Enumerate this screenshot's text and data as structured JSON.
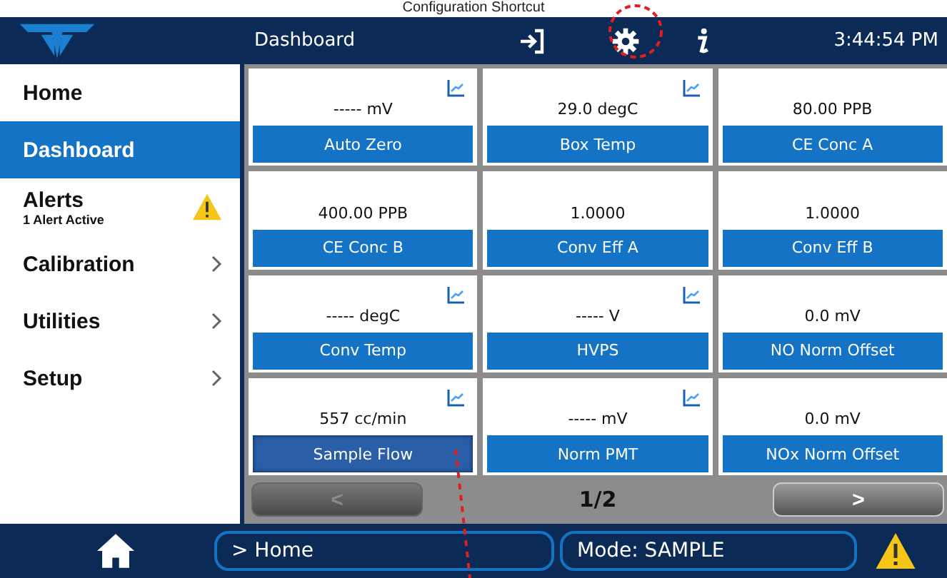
{
  "annotation": {
    "caption": "Configuration Shortcut"
  },
  "header": {
    "title": "Dashboard",
    "time": "3:44:54 PM"
  },
  "sidebar": {
    "items": [
      {
        "label": "Home",
        "selected": false,
        "kind": "plain"
      },
      {
        "label": "Dashboard",
        "selected": true,
        "kind": "plain"
      },
      {
        "label": "Alerts",
        "sub": "1 Alert Active",
        "selected": false,
        "kind": "alert"
      },
      {
        "label": "Calibration",
        "selected": false,
        "kind": "submenu"
      },
      {
        "label": "Utilities",
        "selected": false,
        "kind": "submenu"
      },
      {
        "label": "Setup",
        "selected": false,
        "kind": "submenu"
      }
    ]
  },
  "tiles": [
    {
      "value": "----- mV",
      "label": "Auto Zero",
      "trend": true,
      "selected": false
    },
    {
      "value": "29.0 degC",
      "label": "Box Temp",
      "trend": true,
      "selected": false
    },
    {
      "value": "80.00 PPB",
      "label": "CE Conc A",
      "trend": false,
      "selected": false
    },
    {
      "value": "400.00 PPB",
      "label": "CE Conc B",
      "trend": false,
      "selected": false
    },
    {
      "value": "1.0000",
      "label": "Conv Eff A",
      "trend": false,
      "selected": false
    },
    {
      "value": "1.0000",
      "label": "Conv Eff B",
      "trend": false,
      "selected": false
    },
    {
      "value": "----- degC",
      "label": "Conv Temp",
      "trend": true,
      "selected": false
    },
    {
      "value": "----- V",
      "label": "HVPS",
      "trend": true,
      "selected": false
    },
    {
      "value": "0.0 mV",
      "label": "NO Norm Offset",
      "trend": false,
      "selected": false
    },
    {
      "value": "557 cc/min",
      "label": "Sample Flow",
      "trend": true,
      "selected": true
    },
    {
      "value": "----- mV",
      "label": "Norm PMT",
      "trend": true,
      "selected": false
    },
    {
      "value": "0.0 mV",
      "label": "NOx Norm Offset",
      "trend": false,
      "selected": false
    }
  ],
  "pager": {
    "prev": "<",
    "page": "1/2",
    "next": ">",
    "prev_disabled": true
  },
  "footer": {
    "breadcrumb": "> Home",
    "mode": "Mode: SAMPLE"
  }
}
